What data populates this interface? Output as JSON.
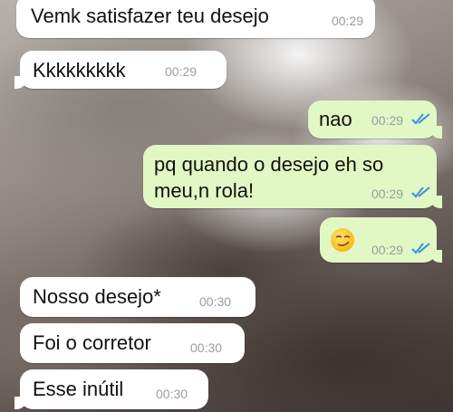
{
  "messages": [
    {
      "text": "Vemk satisfazer teu desejo",
      "time": "00:29"
    },
    {
      "text": "Kkkkkkkkk",
      "time": "00:29"
    },
    {
      "text": "nao",
      "time": "00:29"
    },
    {
      "text": "pq quando o desejo eh so",
      "text2": "meu,n rola!",
      "time": "00:29"
    },
    {
      "emoji": "smirk-emoji",
      "time": "00:29"
    },
    {
      "text": "Nosso desejo*",
      "time": "00:30"
    },
    {
      "text": "Foi o corretor",
      "time": "00:30"
    },
    {
      "text": "Esse inútil",
      "time": "00:30"
    }
  ],
  "colors": {
    "incoming_bubble": "#ffffff",
    "outgoing_bubble": "#e1f7c4",
    "timestamp": "#9c9c9c",
    "read_ticks": "#3a8fe0"
  },
  "icons": {
    "read_receipt": "double-check-icon"
  }
}
